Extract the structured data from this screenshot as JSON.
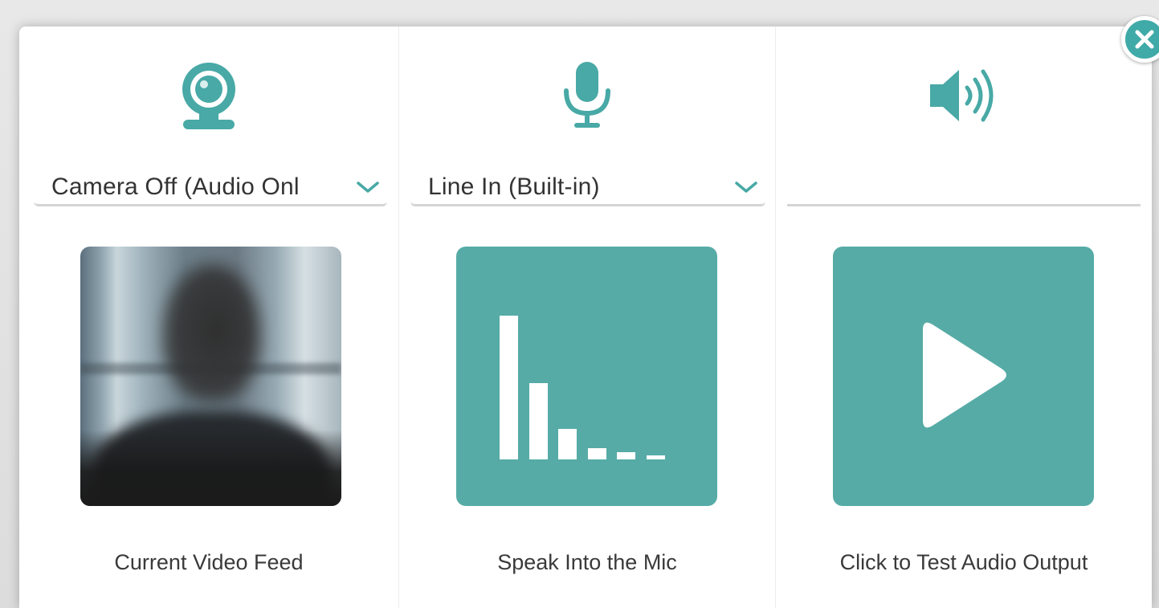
{
  "colors": {
    "accent": "#48a9a6",
    "tile_background": "#56aba6",
    "text": "#333333",
    "close_button": "#40aaa8"
  },
  "dialog": {
    "close_icon": "close-icon"
  },
  "camera": {
    "icon": "webcam-icon",
    "selected_device": "Camera Off (Audio Onl",
    "caption": "Current Video Feed"
  },
  "microphone": {
    "icon": "microphone-icon",
    "selected_device": "Line In (Built-in)",
    "caption": "Speak Into the Mic",
    "level_icon": "audio-level-bars-icon"
  },
  "speaker": {
    "icon": "speaker-volume-icon",
    "selected_device": "",
    "caption": "Click to Test Audio Output",
    "play_icon": "play-icon"
  }
}
